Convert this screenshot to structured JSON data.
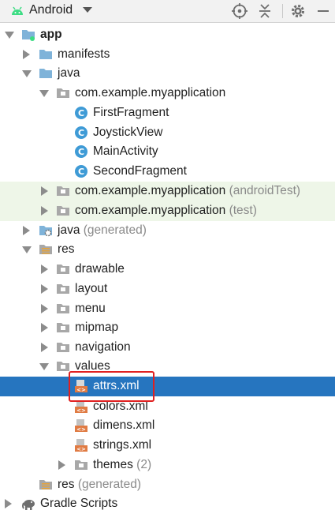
{
  "toolbar": {
    "view_label": "Android",
    "icons": [
      "android-icon",
      "dropdown-arrow-icon",
      "locate-target-icon",
      "collapse-all-icon",
      "settings-gear-icon",
      "minimize-icon"
    ]
  },
  "tree": {
    "app": "app",
    "manifests": "manifests",
    "java": "java",
    "pkg_main": "com.example.myapplication",
    "first_fragment": "FirstFragment",
    "joystick_view": "JoystickView",
    "main_activity": "MainActivity",
    "second_fragment": "SecondFragment",
    "pkg_android_test": "com.example.myapplication",
    "pkg_android_test_hint": "(androidTest)",
    "pkg_test": "com.example.myapplication",
    "pkg_test_hint": "(test)",
    "java_generated": "java",
    "java_generated_hint": "(generated)",
    "res": "res",
    "drawable": "drawable",
    "layout": "layout",
    "menu": "menu",
    "mipmap": "mipmap",
    "navigation": "navigation",
    "values": "values",
    "attrs": "attrs.xml",
    "colors": "colors.xml",
    "dimens": "dimens.xml",
    "strings": "strings.xml",
    "themes": "themes",
    "themes_count": "(2)",
    "res_generated": "res",
    "res_generated_hint": "(generated)",
    "gradle_scripts": "Gradle Scripts"
  },
  "colors": {
    "selection": "#2675bf",
    "scoped_background": "#eef6e8",
    "highlight_border": "#e02020",
    "folder": "#7fb3d9",
    "class_icon": "#3f9bd6",
    "xml_icon": "#e07b43"
  }
}
